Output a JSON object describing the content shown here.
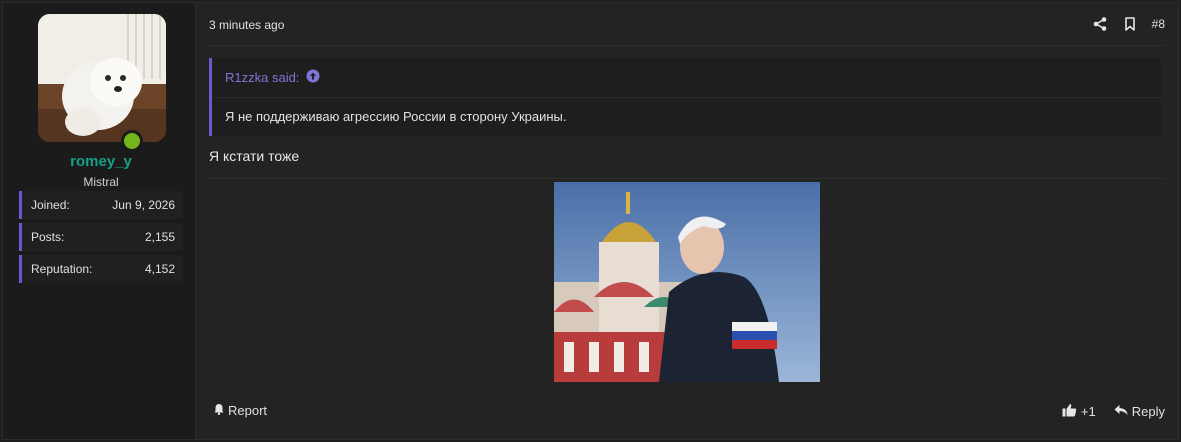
{
  "user": {
    "username": "romey_y",
    "user_title": "Mistral",
    "stats": [
      {
        "label": "Joined:",
        "value": "Jun 9, 2026"
      },
      {
        "label": "Posts:",
        "value": "2,155"
      },
      {
        "label": "Reputation:",
        "value": "4,152"
      }
    ]
  },
  "post": {
    "date": "3 minutes ago",
    "number": "#8",
    "quote": {
      "author_label": "R1zzka said:",
      "text": "Я не поддерживаю агрессию России в сторону Украины."
    },
    "message": "Я кстати тоже",
    "footer": {
      "report_label": "Report",
      "like_count": "+1",
      "reply_label": "Reply"
    }
  },
  "icons": {
    "share": "share-icon",
    "bookmark": "bookmark-icon",
    "quote_link": "arrow-up-circle-icon",
    "report": "bell-icon",
    "like": "thumbs-up-icon",
    "reply": "reply-icon"
  },
  "colors": {
    "accent": "#6a5acd",
    "username": "#16a085",
    "online": "#73b51a",
    "quote_author": "#7f76d6"
  }
}
